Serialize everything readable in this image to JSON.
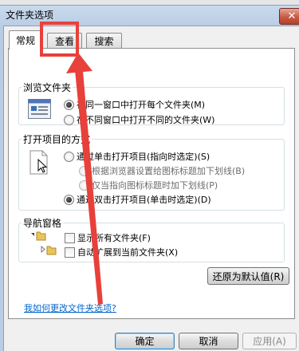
{
  "window": {
    "title": "文件夹选项",
    "close_glyph": "✕"
  },
  "tabs": [
    {
      "label": "常规",
      "active": true
    },
    {
      "label": "查看",
      "active": false
    },
    {
      "label": "搜索",
      "active": false
    }
  ],
  "browse_folders": {
    "legend": "浏览文件夹",
    "options": [
      {
        "label": "在同一窗口中打开每个文件夹(M)",
        "selected": true
      },
      {
        "label": "在不同窗口中打开不同的文件夹(W)",
        "selected": false
      }
    ]
  },
  "click_items": {
    "legend": "打开项目的方式",
    "options": [
      {
        "label": "通过单击打开项目(指向时选定)(S)",
        "selected": false
      },
      {
        "label": "根据浏览器设置给图标标题加下划线(B)",
        "selected": false,
        "disabled": true
      },
      {
        "label": "仅当指向图标标题时加下划线(P)",
        "selected": false,
        "disabled": true
      },
      {
        "label": "通过双击打开项目(单击时选定)(D)",
        "selected": true
      }
    ]
  },
  "nav_pane": {
    "legend": "导航窗格",
    "options": [
      {
        "label": "显示所有文件夹(F)",
        "checked": false
      },
      {
        "label": "自动扩展到当前文件夹(X)",
        "checked": false
      }
    ]
  },
  "restore_defaults_label": "还原为默认值(R)",
  "help_link": "我如何更改文件夹选项?",
  "buttons": {
    "ok": "确定",
    "cancel": "取消",
    "apply": "应用(A)"
  },
  "colors": {
    "annotation": "#e8403a",
    "link": "#0066cc"
  }
}
